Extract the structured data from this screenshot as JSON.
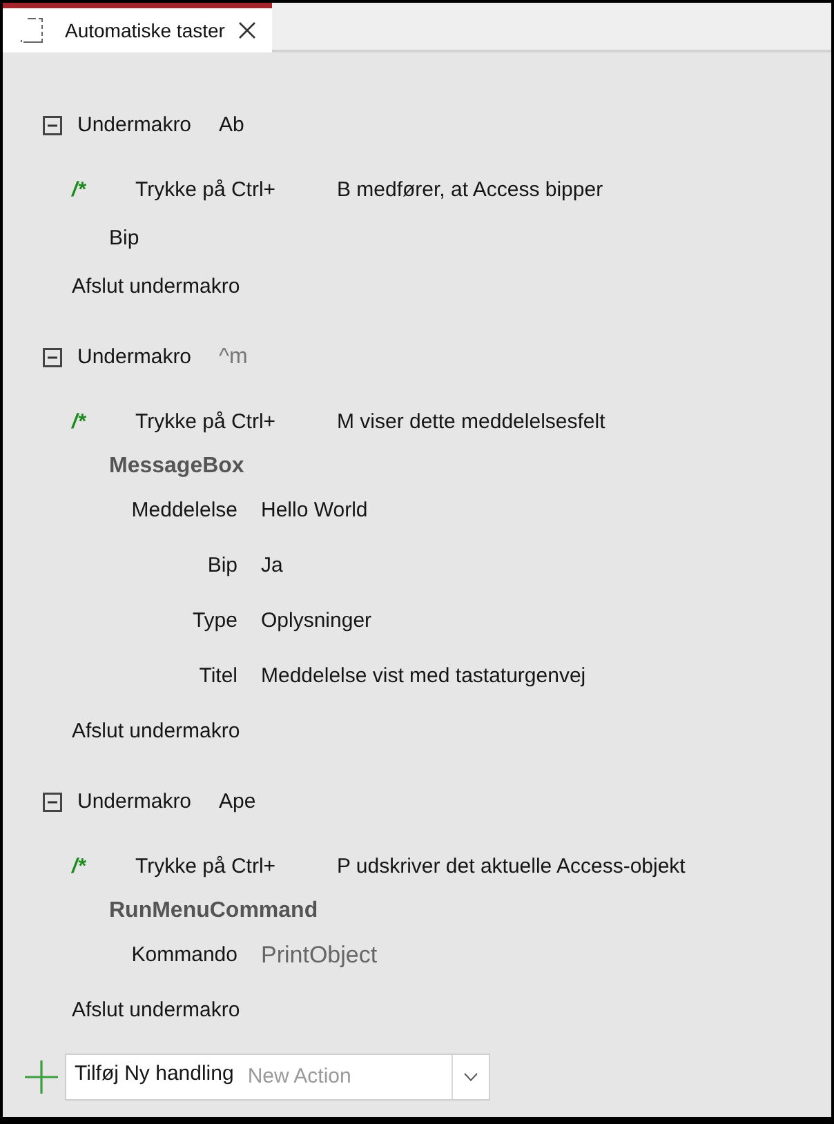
{
  "tab": {
    "title": "Automatiske taster",
    "selected": true
  },
  "submacros": [
    {
      "expanded": true,
      "keyword": "Undermakro",
      "name": "Ab",
      "name_muted": false,
      "comment": {
        "marker": "/*",
        "text": "Trykke på Ctrl+",
        "detail": "B medfører, at Access bipper"
      },
      "actions": [
        {
          "name": "Bip",
          "expanded": false
        }
      ],
      "end": "Afslut undermakro"
    },
    {
      "expanded": true,
      "keyword": "Undermakro",
      "name": "^m",
      "name_muted": true,
      "comment": {
        "marker": "/*",
        "text": "Trykke på Ctrl+",
        "detail": "M viser dette meddelelsesfelt"
      },
      "actions": [
        {
          "name": "MessageBox",
          "expanded": true,
          "arguments": [
            {
              "label": "Meddelelse",
              "value": "Hello World",
              "muted": false
            },
            {
              "label": "Bip",
              "value": "Ja",
              "muted": false
            },
            {
              "label": "Type",
              "value": "Oplysninger",
              "muted": false
            },
            {
              "label": "Titel",
              "value": "Meddelelse vist med tastaturgenvej",
              "muted": false
            }
          ]
        }
      ],
      "end": "Afslut undermakro"
    },
    {
      "expanded": true,
      "keyword": "Undermakro",
      "name": "Ape",
      "name_muted": false,
      "comment": {
        "marker": "/*",
        "text": "Trykke på Ctrl+",
        "detail": "P udskriver det aktuelle Access-objekt"
      },
      "actions": [
        {
          "name": "RunMenuCommand",
          "expanded": true,
          "arguments": [
            {
              "label": "Kommando",
              "value": "PrintObject",
              "muted": true
            }
          ]
        }
      ],
      "end": "Afslut undermakro"
    }
  ],
  "new_action": {
    "label": "Tilføj Ny handling",
    "placeholder": "New Action"
  }
}
